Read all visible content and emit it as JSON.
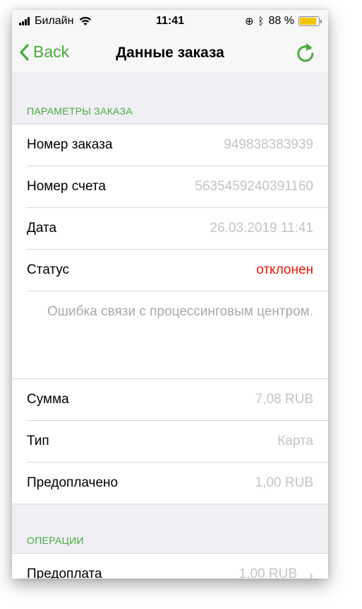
{
  "status_bar": {
    "carrier": "Билайн",
    "time": "11:41",
    "battery_text": "88 %",
    "battery_level": 0.88,
    "battery_color": "#f5c400"
  },
  "nav": {
    "back_label": "Back",
    "title": "Данные заказа",
    "accent_color": "#4aab3e"
  },
  "sections": {
    "params_header": "ПАРАМЕТРЫ ЗАКАЗА",
    "operations_header": "ОПЕРАЦИИ"
  },
  "order": {
    "number_label": "Номер заказа",
    "number_value": "949838383939",
    "account_label": "Номер счета",
    "account_value": "5635459240391160",
    "date_label": "Дата",
    "date_value": "26.03.2019 11:41",
    "status_label": "Статус",
    "status_value": "отклонен",
    "status_color": "#e8160c",
    "error_message": "Ошибка связи с процессинговым центром.",
    "sum_label": "Сумма",
    "sum_value": "7,08 RUB",
    "type_label": "Тип",
    "type_value": "Карта",
    "prepaid_label": "Предоплачено",
    "prepaid_value": "1,00 RUB"
  },
  "operations": [
    {
      "label": "Предоплата",
      "value": "1,00 RUB"
    }
  ],
  "icons": {
    "back": "chevron-left-icon",
    "refresh": "refresh-icon",
    "row_chevron": "chevron-right-icon"
  }
}
